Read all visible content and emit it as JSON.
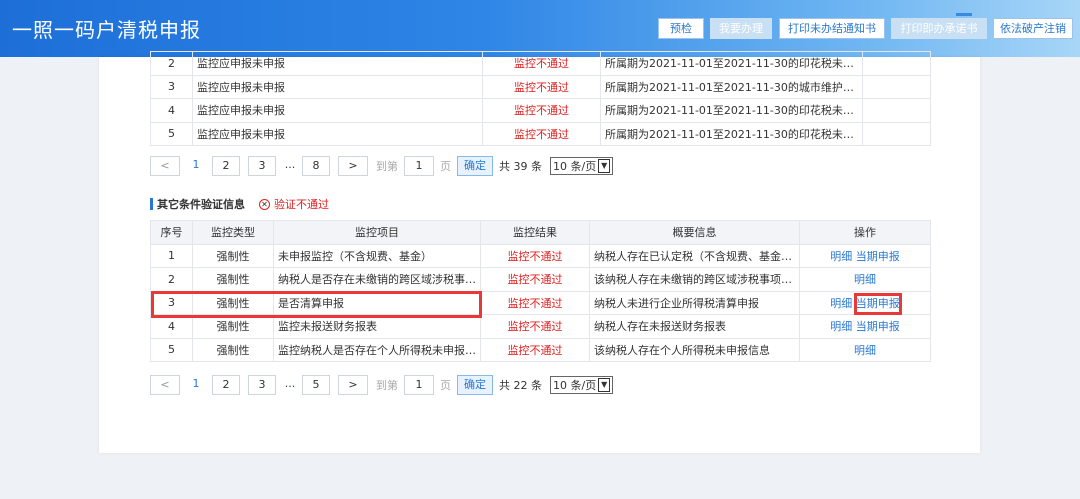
{
  "header": {
    "title": "一照一码户清税申报",
    "buttons": [
      {
        "label": "预检",
        "disabled": false
      },
      {
        "label": "我要办理",
        "disabled": true
      },
      {
        "label": "打印未办结通知书",
        "disabled": false
      },
      {
        "label": "打印即办承诺书",
        "disabled": true
      },
      {
        "label": "依法破产注销",
        "disabled": false
      }
    ]
  },
  "top_table": {
    "rows": [
      {
        "no": "2",
        "item": "监控应申报未申报",
        "result": "监控不通过",
        "summary": "所属期为2021-11-01至2021-11-30的印花税未申报！"
      },
      {
        "no": "3",
        "item": "监控应申报未申报",
        "result": "监控不通过",
        "summary": "所属期为2021-11-01至2021-11-30的城市维护建设税..."
      },
      {
        "no": "4",
        "item": "监控应申报未申报",
        "result": "监控不通过",
        "summary": "所属期为2021-11-01至2021-11-30的印花税未申报！"
      },
      {
        "no": "5",
        "item": "监控应申报未申报",
        "result": "监控不通过",
        "summary": "所属期为2021-11-01至2021-11-30的印花税未申报！"
      }
    ]
  },
  "pager1": {
    "prev": "<",
    "pages": [
      "1",
      "2",
      "3"
    ],
    "dots": "...",
    "last": "8",
    "next": ">",
    "goto_label": "到第",
    "page_input": "1",
    "page_unit": "页",
    "confirm": "确定",
    "total": "共 39 条",
    "page_size": "10 条/页"
  },
  "section": {
    "title": "其它条件验证信息",
    "status_icon": "close-circle-icon",
    "status": "验证不通过"
  },
  "table2": {
    "headers": [
      "序号",
      "监控类型",
      "监控项目",
      "监控结果",
      "概要信息",
      "操作"
    ],
    "rows": [
      {
        "no": "1",
        "type": "强制性",
        "item": "未申报监控（不含规费、基金）",
        "result": "监控不通过",
        "summary": "纳税人存在已认定税（不含规费、基金）未...",
        "detail": "明细",
        "action": "当期申报"
      },
      {
        "no": "2",
        "type": "强制性",
        "item": "纳税人是否存在未缴销的跨区域涉税事项报...",
        "result": "监控不通过",
        "summary": "该纳税人存在未缴销的跨区域涉税事项报告",
        "detail": "明细",
        "action": ""
      },
      {
        "no": "3",
        "type": "强制性",
        "item": "是否清算申报",
        "result": "监控不通过",
        "summary": "纳税人未进行企业所得税清算申报",
        "detail": "明细",
        "action": "当期申报"
      },
      {
        "no": "4",
        "type": "强制性",
        "item": "监控未报送财务报表",
        "result": "监控不通过",
        "summary": "纳税人存在未报送财务报表",
        "detail": "明细",
        "action": "当期申报"
      },
      {
        "no": "5",
        "type": "强制性",
        "item": "监控纳税人是否存在个人所得税未申报信息",
        "result": "监控不通过",
        "summary": "该纳税人存在个人所得税未申报信息",
        "detail": "明细",
        "action": ""
      }
    ]
  },
  "pager2": {
    "prev": "<",
    "pages": [
      "1",
      "2",
      "3"
    ],
    "dots": "...",
    "last": "5",
    "next": ">",
    "goto_label": "到第",
    "page_input": "1",
    "page_unit": "页",
    "confirm": "确定",
    "total": "共 22 条",
    "page_size": "10 条/页"
  },
  "colors": {
    "accent": "#2a78d1",
    "fail": "#e02020",
    "highlight": "#e83838"
  }
}
